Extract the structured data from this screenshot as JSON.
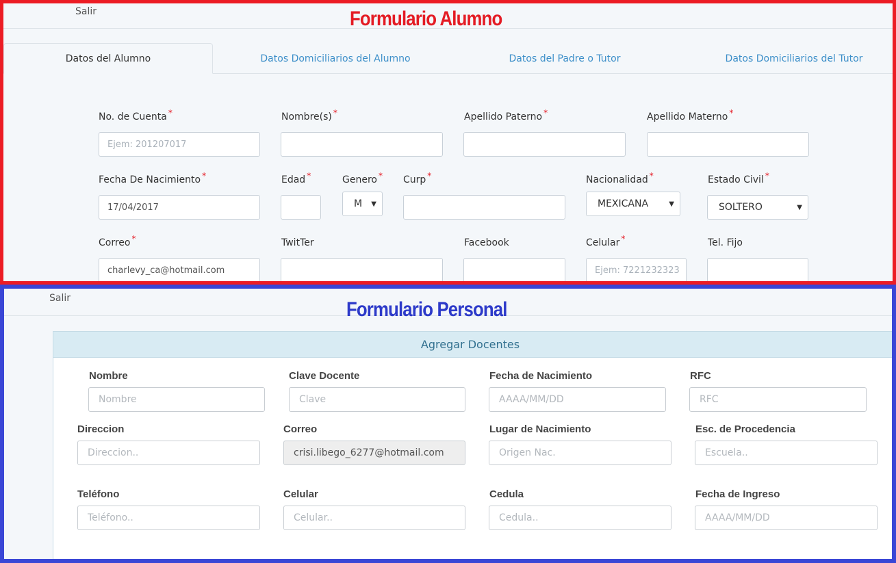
{
  "panel_alumno": {
    "salir": "Salir",
    "title": "Formulario Alumno",
    "tabs": [
      {
        "label": "Datos del Alumno"
      },
      {
        "label": "Datos Domiciliarios del Alumno"
      },
      {
        "label": "Datos del Padre o Tutor"
      },
      {
        "label": "Datos Domiciliarios del Tutor"
      }
    ],
    "fields": {
      "cuenta": {
        "label": "No. de Cuenta",
        "placeholder": "Ejem: 201207017"
      },
      "nombre": {
        "label": "Nombre(s)"
      },
      "paterno": {
        "label": "Apellido Paterno"
      },
      "materno": {
        "label": "Apellido Materno"
      },
      "fecha": {
        "label": "Fecha De Nacimiento",
        "value": "17/04/2017"
      },
      "edad": {
        "label": "Edad"
      },
      "genero": {
        "label": "Genero",
        "value": "M"
      },
      "curp": {
        "label": "Curp"
      },
      "nacionalidad": {
        "label": "Nacionalidad",
        "value": "MEXICANA"
      },
      "civil": {
        "label": "Estado Civil",
        "value": "SOLTERO"
      },
      "correo": {
        "label": "Correo",
        "value": "charlevy_ca@hotmail.com"
      },
      "twitter": {
        "label": "TwitTer"
      },
      "facebook": {
        "label": "Facebook"
      },
      "celular": {
        "label": "Celular",
        "placeholder": "Ejem: 7221232323"
      },
      "fijo": {
        "label": "Tel. Fijo"
      }
    },
    "required_mark": "*"
  },
  "panel_personal": {
    "salir": "Salir",
    "title": "Formulario Personal",
    "card_title": "Agregar Docentes",
    "fields": {
      "nombre": {
        "label": "Nombre",
        "placeholder": "Nombre"
      },
      "clave": {
        "label": "Clave Docente",
        "placeholder": "Clave"
      },
      "fecha_nac": {
        "label": "Fecha de Nacimiento",
        "placeholder": "AAAA/MM/DD"
      },
      "rfc": {
        "label": "RFC",
        "placeholder": "RFC"
      },
      "direccion": {
        "label": "Direccion",
        "placeholder": "Direccion.."
      },
      "correo": {
        "label": "Correo",
        "value": "crisi.libego_6277@hotmail.com"
      },
      "lugar": {
        "label": "Lugar de Nacimiento",
        "placeholder": "Origen Nac."
      },
      "escuela": {
        "label": "Esc. de Procedencia",
        "placeholder": "Escuela.."
      },
      "telefono": {
        "label": "Teléfono",
        "placeholder": "Teléfono.."
      },
      "celular": {
        "label": "Celular",
        "placeholder": "Celular.."
      },
      "cedula": {
        "label": "Cedula",
        "placeholder": "Cedula.."
      },
      "ingreso": {
        "label": "Fecha de Ingreso",
        "placeholder": "AAAA/MM/DD"
      }
    }
  },
  "colors": {
    "alumno_border": "#ec1c24",
    "personal_border": "#3a46d6",
    "tab_link": "#3d8fc9"
  }
}
